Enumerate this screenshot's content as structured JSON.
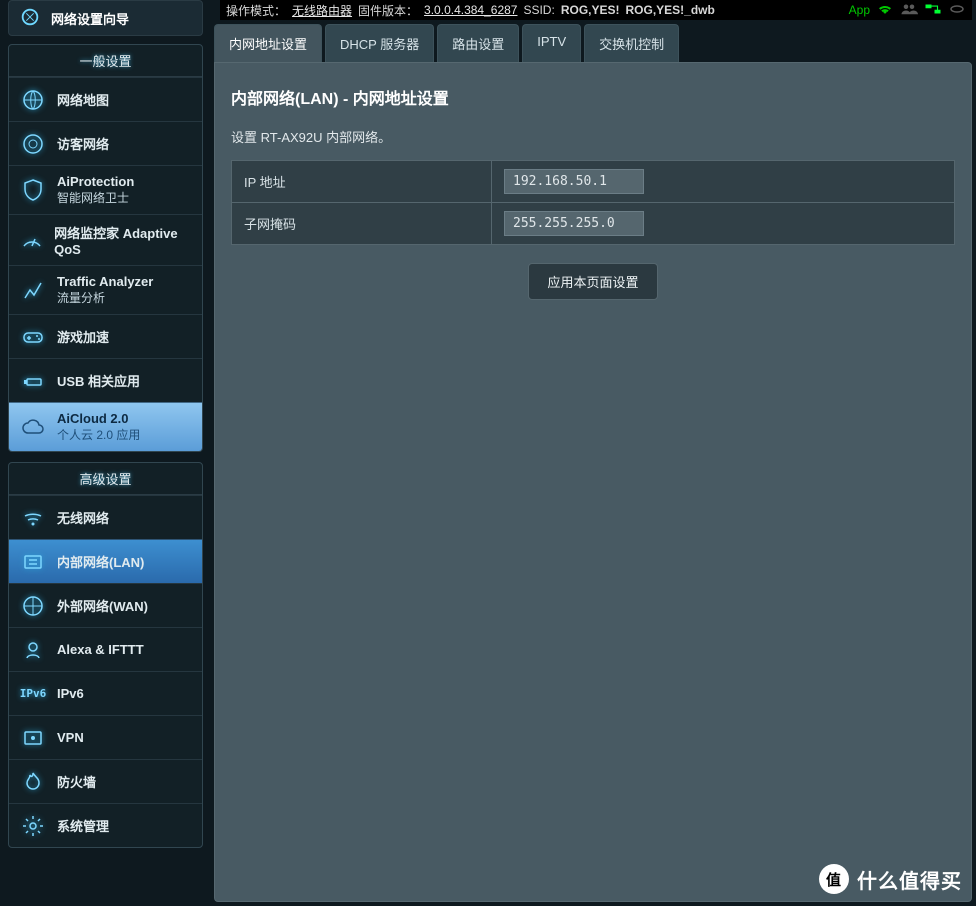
{
  "status": {
    "mode_label": "操作模式：",
    "mode_value": "无线路由器",
    "fw_label": "固件版本：",
    "fw_value": "3.0.0.4.384_6287",
    "ssid_label": "SSID:",
    "ssid_1": "ROG,YES!",
    "ssid_2": "ROG,YES!_dwb",
    "app_label": "App"
  },
  "wizard": {
    "label": "网络设置向导"
  },
  "sections": {
    "general_title": "一般设置",
    "advanced_title": "高级设置"
  },
  "menu_general": [
    {
      "label": "网络地图"
    },
    {
      "label": "访客网络"
    },
    {
      "label": "AiProtection",
      "sub": "智能网络卫士"
    },
    {
      "label": "网络监控家 Adaptive QoS"
    },
    {
      "label": "Traffic Analyzer",
      "sub": "流量分析"
    },
    {
      "label": "游戏加速"
    },
    {
      "label": "USB 相关应用"
    },
    {
      "label": "AiCloud 2.0",
      "sub": "个人云 2.0 应用"
    }
  ],
  "menu_advanced": [
    {
      "label": "无线网络"
    },
    {
      "label": "内部网络(LAN)"
    },
    {
      "label": "外部网络(WAN)"
    },
    {
      "label": "Alexa & IFTTT"
    },
    {
      "label": "IPv6"
    },
    {
      "label": "VPN"
    },
    {
      "label": "防火墙"
    },
    {
      "label": "系统管理"
    }
  ],
  "tabs": [
    "内网地址设置",
    "DHCP 服务器",
    "路由设置",
    "IPTV",
    "交换机控制"
  ],
  "page": {
    "title": "内部网络(LAN) - 内网地址设置",
    "desc": "设置 RT-AX92U 内部网络。",
    "ip_label": "IP 地址",
    "ip_value": "192.168.50.1",
    "mask_label": "子网掩码",
    "mask_value": "255.255.255.0",
    "apply_label": "应用本页面设置"
  },
  "watermark": "什么值得买"
}
